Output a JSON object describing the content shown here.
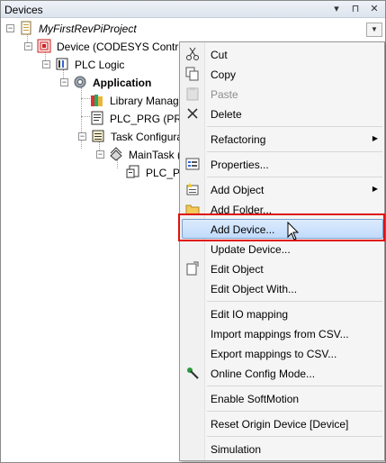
{
  "panel": {
    "title": "Devices",
    "controls": [
      "▾",
      "⊓",
      "✕"
    ]
  },
  "tree": [
    {
      "label": "MyFirstRevPiProject",
      "icon": "project-icon",
      "italic": true
    },
    {
      "label": "Device (CODESYS Control fo",
      "icon": "device-icon"
    },
    {
      "label": "PLC Logic",
      "icon": "plc-logic-icon"
    },
    {
      "label": "Application",
      "icon": "application-gear-icon",
      "bold": true
    },
    {
      "label": "Library Manager",
      "icon": "library-icon"
    },
    {
      "label": "PLC_PRG (PRG)",
      "icon": "program-icon"
    },
    {
      "label": "Task Configurati",
      "icon": "task-config-icon"
    },
    {
      "label": "MainTask (I",
      "icon": "task-icon"
    },
    {
      "label": "PLC_PR",
      "icon": "program-call-icon"
    }
  ],
  "menu": {
    "items": [
      {
        "label": "Cut",
        "icon": "scissors-icon"
      },
      {
        "label": "Copy",
        "icon": "copy-icon"
      },
      {
        "label": "Paste",
        "icon": "paste-icon",
        "disabled": true
      },
      {
        "label": "Delete",
        "icon": "delete-icon"
      },
      {
        "label": "Refactoring",
        "submenu": true
      },
      {
        "label": "Properties...",
        "icon": "properties-icon"
      },
      {
        "label": "Add Object",
        "icon": "add-object-icon",
        "submenu": true
      },
      {
        "label": "Add Folder...",
        "icon": "folder-icon"
      },
      {
        "label": "Add Device...",
        "highlighted": true
      },
      {
        "label": "Update Device..."
      },
      {
        "label": "Edit Object",
        "icon": "edit-object-icon"
      },
      {
        "label": "Edit Object With..."
      },
      {
        "label": "Edit IO mapping"
      },
      {
        "label": "Import mappings from CSV..."
      },
      {
        "label": "Export mappings to CSV..."
      },
      {
        "label": "Online Config Mode...",
        "icon": "online-config-icon"
      },
      {
        "label": "Enable SoftMotion"
      },
      {
        "label": "Reset Origin Device [Device]"
      },
      {
        "label": "Simulation"
      }
    ]
  },
  "colors": {
    "highlight_border": "#e01010",
    "selection": "#c1dbfc"
  }
}
